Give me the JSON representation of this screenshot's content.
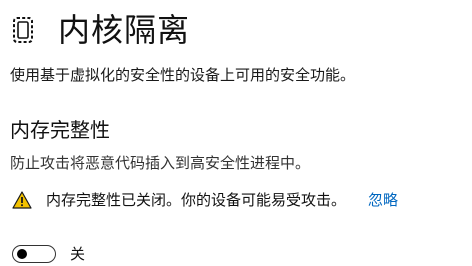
{
  "header": {
    "title": "内核隔离",
    "icon": "shield-chip-icon"
  },
  "description": "使用基于虚拟化的安全性的设备上可用的安全功能。",
  "memory_integrity": {
    "title": "内存完整性",
    "description": "防止攻击将恶意代码插入到高安全性进程中。",
    "warning": {
      "icon": "warning-icon",
      "text": "内存完整性已关闭。你的设备可能易受攻击。",
      "dismiss_label": "忽略"
    },
    "toggle": {
      "state": "off",
      "label": "关"
    }
  },
  "colors": {
    "link": "#0067c0",
    "warning_fill": "#f3c200"
  }
}
